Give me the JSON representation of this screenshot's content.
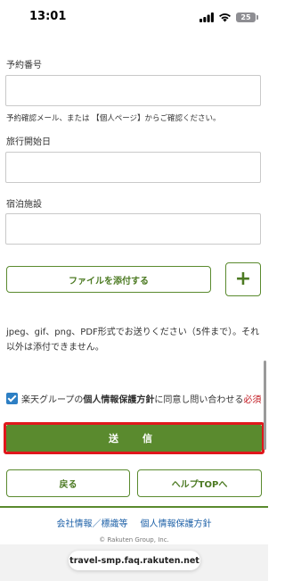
{
  "status_bar": {
    "time": "13:01",
    "battery": "25"
  },
  "form": {
    "reservation_label": "予約番号",
    "reservation_note": "予約確認メール、または 【個人ページ】からご確認ください。",
    "travel_start_label": "旅行開始日",
    "lodging_label": "宿泊施設",
    "attach_button": "ファイルを添付する",
    "add_button": "+",
    "file_note": "jpeg、gif、png、PDF形式でお送りください（5件まで）。それ以外は添付できません。",
    "consent_prefix": "楽天グループの",
    "consent_link": "個人情報保護方針",
    "consent_suffix": "に同意し問い合わせる",
    "required": "必須",
    "submit_button": "送　信",
    "back_button": "戻る",
    "help_top_button": "ヘルプTOPへ"
  },
  "footer": {
    "link_company": "会社情報／標識等",
    "link_privacy": "個人情報保護方針",
    "copyright": "© Rakuten Group, Inc."
  },
  "browser": {
    "url": "travel-smp.faq.rakuten.net"
  },
  "colors": {
    "accent_green": "#5a8a2e",
    "highlight_red": "#e0171c",
    "link_blue": "#1f62a8",
    "checkbox_blue": "#2d7fc4"
  }
}
